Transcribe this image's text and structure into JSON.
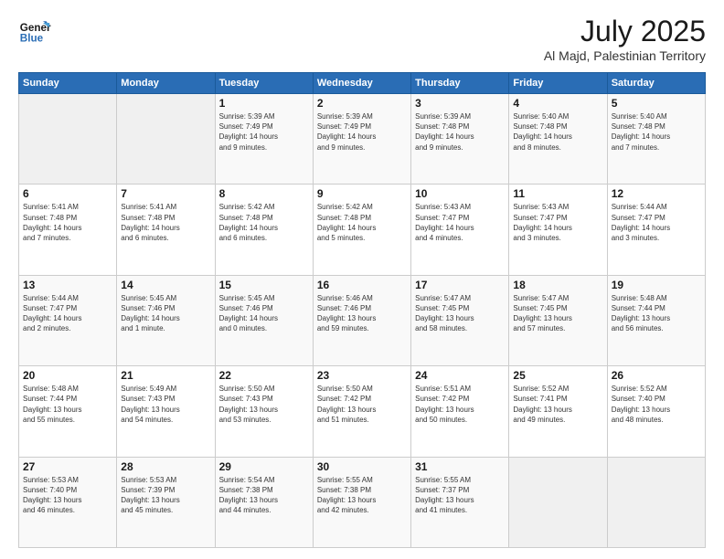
{
  "header": {
    "logo_line1": "General",
    "logo_line2": "Blue",
    "month": "July 2025",
    "location": "Al Majd, Palestinian Territory"
  },
  "weekdays": [
    "Sunday",
    "Monday",
    "Tuesday",
    "Wednesday",
    "Thursday",
    "Friday",
    "Saturday"
  ],
  "weeks": [
    [
      {
        "day": "",
        "info": ""
      },
      {
        "day": "",
        "info": ""
      },
      {
        "day": "1",
        "info": "Sunrise: 5:39 AM\nSunset: 7:49 PM\nDaylight: 14 hours\nand 9 minutes."
      },
      {
        "day": "2",
        "info": "Sunrise: 5:39 AM\nSunset: 7:49 PM\nDaylight: 14 hours\nand 9 minutes."
      },
      {
        "day": "3",
        "info": "Sunrise: 5:39 AM\nSunset: 7:48 PM\nDaylight: 14 hours\nand 9 minutes."
      },
      {
        "day": "4",
        "info": "Sunrise: 5:40 AM\nSunset: 7:48 PM\nDaylight: 14 hours\nand 8 minutes."
      },
      {
        "day": "5",
        "info": "Sunrise: 5:40 AM\nSunset: 7:48 PM\nDaylight: 14 hours\nand 7 minutes."
      }
    ],
    [
      {
        "day": "6",
        "info": "Sunrise: 5:41 AM\nSunset: 7:48 PM\nDaylight: 14 hours\nand 7 minutes."
      },
      {
        "day": "7",
        "info": "Sunrise: 5:41 AM\nSunset: 7:48 PM\nDaylight: 14 hours\nand 6 minutes."
      },
      {
        "day": "8",
        "info": "Sunrise: 5:42 AM\nSunset: 7:48 PM\nDaylight: 14 hours\nand 6 minutes."
      },
      {
        "day": "9",
        "info": "Sunrise: 5:42 AM\nSunset: 7:48 PM\nDaylight: 14 hours\nand 5 minutes."
      },
      {
        "day": "10",
        "info": "Sunrise: 5:43 AM\nSunset: 7:47 PM\nDaylight: 14 hours\nand 4 minutes."
      },
      {
        "day": "11",
        "info": "Sunrise: 5:43 AM\nSunset: 7:47 PM\nDaylight: 14 hours\nand 3 minutes."
      },
      {
        "day": "12",
        "info": "Sunrise: 5:44 AM\nSunset: 7:47 PM\nDaylight: 14 hours\nand 3 minutes."
      }
    ],
    [
      {
        "day": "13",
        "info": "Sunrise: 5:44 AM\nSunset: 7:47 PM\nDaylight: 14 hours\nand 2 minutes."
      },
      {
        "day": "14",
        "info": "Sunrise: 5:45 AM\nSunset: 7:46 PM\nDaylight: 14 hours\nand 1 minute."
      },
      {
        "day": "15",
        "info": "Sunrise: 5:45 AM\nSunset: 7:46 PM\nDaylight: 14 hours\nand 0 minutes."
      },
      {
        "day": "16",
        "info": "Sunrise: 5:46 AM\nSunset: 7:46 PM\nDaylight: 13 hours\nand 59 minutes."
      },
      {
        "day": "17",
        "info": "Sunrise: 5:47 AM\nSunset: 7:45 PM\nDaylight: 13 hours\nand 58 minutes."
      },
      {
        "day": "18",
        "info": "Sunrise: 5:47 AM\nSunset: 7:45 PM\nDaylight: 13 hours\nand 57 minutes."
      },
      {
        "day": "19",
        "info": "Sunrise: 5:48 AM\nSunset: 7:44 PM\nDaylight: 13 hours\nand 56 minutes."
      }
    ],
    [
      {
        "day": "20",
        "info": "Sunrise: 5:48 AM\nSunset: 7:44 PM\nDaylight: 13 hours\nand 55 minutes."
      },
      {
        "day": "21",
        "info": "Sunrise: 5:49 AM\nSunset: 7:43 PM\nDaylight: 13 hours\nand 54 minutes."
      },
      {
        "day": "22",
        "info": "Sunrise: 5:50 AM\nSunset: 7:43 PM\nDaylight: 13 hours\nand 53 minutes."
      },
      {
        "day": "23",
        "info": "Sunrise: 5:50 AM\nSunset: 7:42 PM\nDaylight: 13 hours\nand 51 minutes."
      },
      {
        "day": "24",
        "info": "Sunrise: 5:51 AM\nSunset: 7:42 PM\nDaylight: 13 hours\nand 50 minutes."
      },
      {
        "day": "25",
        "info": "Sunrise: 5:52 AM\nSunset: 7:41 PM\nDaylight: 13 hours\nand 49 minutes."
      },
      {
        "day": "26",
        "info": "Sunrise: 5:52 AM\nSunset: 7:40 PM\nDaylight: 13 hours\nand 48 minutes."
      }
    ],
    [
      {
        "day": "27",
        "info": "Sunrise: 5:53 AM\nSunset: 7:40 PM\nDaylight: 13 hours\nand 46 minutes."
      },
      {
        "day": "28",
        "info": "Sunrise: 5:53 AM\nSunset: 7:39 PM\nDaylight: 13 hours\nand 45 minutes."
      },
      {
        "day": "29",
        "info": "Sunrise: 5:54 AM\nSunset: 7:38 PM\nDaylight: 13 hours\nand 44 minutes."
      },
      {
        "day": "30",
        "info": "Sunrise: 5:55 AM\nSunset: 7:38 PM\nDaylight: 13 hours\nand 42 minutes."
      },
      {
        "day": "31",
        "info": "Sunrise: 5:55 AM\nSunset: 7:37 PM\nDaylight: 13 hours\nand 41 minutes."
      },
      {
        "day": "",
        "info": ""
      },
      {
        "day": "",
        "info": ""
      }
    ]
  ]
}
